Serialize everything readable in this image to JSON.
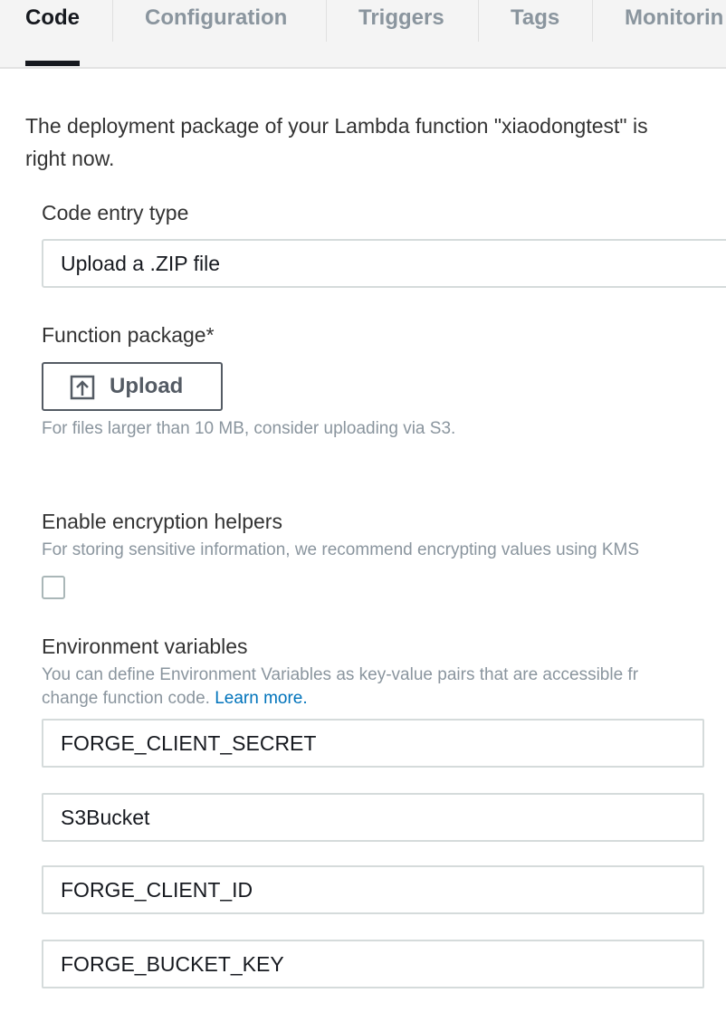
{
  "tabs": [
    {
      "label": "Code",
      "active": true
    },
    {
      "label": "Configuration",
      "active": false
    },
    {
      "label": "Triggers",
      "active": false
    },
    {
      "label": "Tags",
      "active": false
    },
    {
      "label": "Monitorin",
      "active": false
    }
  ],
  "intro": {
    "line1": "The deployment package of your Lambda function \"xiaodongtest\" is",
    "line2": "right now."
  },
  "code_entry": {
    "label": "Code entry type",
    "value": "Upload a .ZIP file"
  },
  "function_package": {
    "label": "Function package*",
    "upload_label": "Upload",
    "upload_icon": "upload-icon",
    "hint": "For files larger than 10 MB, consider uploading via S3."
  },
  "encryption": {
    "label": "Enable encryption helpers",
    "hint": "For storing sensitive information, we recommend encrypting values using KMS",
    "checked": false
  },
  "env": {
    "label": "Environment variables",
    "hint_line1": "You can define Environment Variables as key-value pairs that are accessible fr",
    "hint_line2": "change function code.",
    "learn_more": "Learn more.",
    "keys": [
      "FORGE_CLIENT_SECRET",
      "S3Bucket",
      "FORGE_CLIENT_ID",
      "FORGE_BUCKET_KEY"
    ]
  },
  "colors": {
    "active_tab": "#16191f",
    "inactive_tab": "#8a959e",
    "link": "#0073bb",
    "border": "#d5dbdb"
  }
}
